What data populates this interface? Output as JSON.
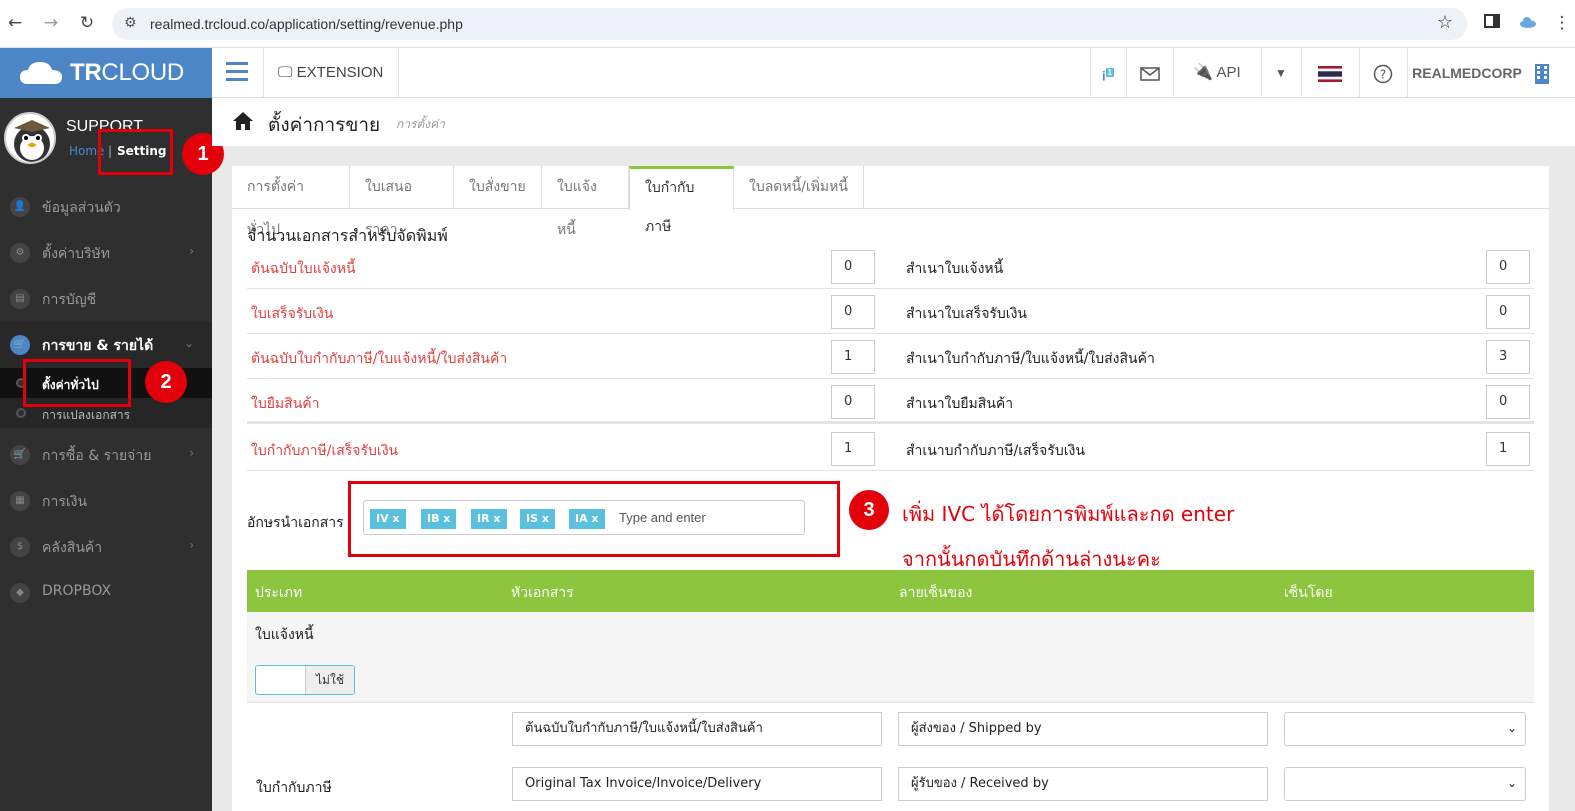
{
  "browser": {
    "url": "realmed.trcloud.co/application/setting/revenue.php"
  },
  "topbar": {
    "logo_tr": "TR",
    "logo_cloud": "CLOUD",
    "extension": "EXTENSION",
    "api": "API",
    "company": "REALMEDCORP"
  },
  "sidebar": {
    "profile_name": "SUPPORT",
    "crumb_home": "Home",
    "crumb_setting": "Setting",
    "items": [
      {
        "label": "ข้อมูลส่วนตัว"
      },
      {
        "label": "ตั้งค่าบริษัท"
      },
      {
        "label": "การบัญชี"
      },
      {
        "label": "การขาย & รายได้"
      },
      {
        "label": "การซื้อ & รายจ่าย"
      },
      {
        "label": "การเงิน"
      },
      {
        "label": "คลังสินค้า"
      },
      {
        "label": "DROPBOX"
      }
    ],
    "sub_items": [
      {
        "label": "ตั้งค่าทั่วไป"
      },
      {
        "label": "การแปลงเอกสาร"
      }
    ]
  },
  "markers": [
    "1",
    "2",
    "3"
  ],
  "page": {
    "title": "ตั้งค่าการขาย",
    "subtitle": "การตั้งค่า"
  },
  "tabs": [
    "การตั้งค่าทั่วไป",
    "ใบเสนอราคา",
    "ใบสั่งขาย",
    "ใบแจ้งหนี้",
    "ใบกำกับภาษี",
    "ใบลดหนี้/เพิ่มหนี้"
  ],
  "active_tab": "ใบกำกับภาษี",
  "print_section": {
    "title": "จำนวนเอกสารสำหรับจัดพิมพ์",
    "rows": [
      {
        "left_label": "ต้นฉบับใบแจ้งหนี้",
        "left_value": "0",
        "right_label": "สำเนาใบแจ้งหนี้",
        "right_value": "0"
      },
      {
        "left_label": "ใบเสร็จรับเงิน",
        "left_value": "0",
        "right_label": "สำเนาใบเสร็จรับเงิน",
        "right_value": "0"
      },
      {
        "left_label": "ต้นฉบับใบกำกับภาษี/ใบแจ้งหนี้/ใบส่งสินค้า",
        "left_value": "1",
        "right_label": "สำเนาใบกำกับภาษี/ใบแจ้งหนี้/ใบส่งสินค้า",
        "right_value": "3"
      },
      {
        "left_label": "ใบยืมสินค้า",
        "left_value": "0",
        "right_label": "สำเนาใบยืมสินค้า",
        "right_value": "0"
      },
      {
        "left_label": "ใบกำกับภาษี/เสร็จรับเงิน",
        "left_value": "1",
        "right_label": "สำเนาบกำกับภาษี/เสร็จรับเงิน",
        "right_value": "1"
      }
    ]
  },
  "prefix": {
    "label": "อักษรนำเอกสาร",
    "tags": [
      "IV x",
      "IB x",
      "IR x",
      "IS x",
      "IA x"
    ],
    "placeholder": "Type and enter"
  },
  "notes": {
    "line1": "เพิ่ม IVC ได้โดยการพิมพ์และกด enter",
    "line2": "จากนั้นกดบันทึกด้านล่างนะคะ"
  },
  "sign_table": {
    "headers": [
      "ประเภท",
      "หัวเอกสาร",
      "ลายเซ็นของ",
      "เซ็นโดย"
    ],
    "section_title": "ใบแจ้งหนี้",
    "toggle_off": "ไม่ใช้",
    "rows": [
      {
        "type": "",
        "header": "ต้นฉบับใบกำกับภาษี/ใบแจ้งหนี้/ใบส่งสินค้า",
        "signature": "ผู้ส่งของ / Shipped by",
        "signer": ""
      },
      {
        "type": "ใบกำกับภาษี",
        "header": "Original Tax Invoice/Invoice/Delivery",
        "signature": "ผู้รับของ / Received by",
        "signer": ""
      }
    ]
  },
  "colors": {
    "brand_blue": "#4c86c6",
    "green": "#8dc53f",
    "annotation_red": "#e3000b",
    "tag_blue": "#5bc0de"
  }
}
